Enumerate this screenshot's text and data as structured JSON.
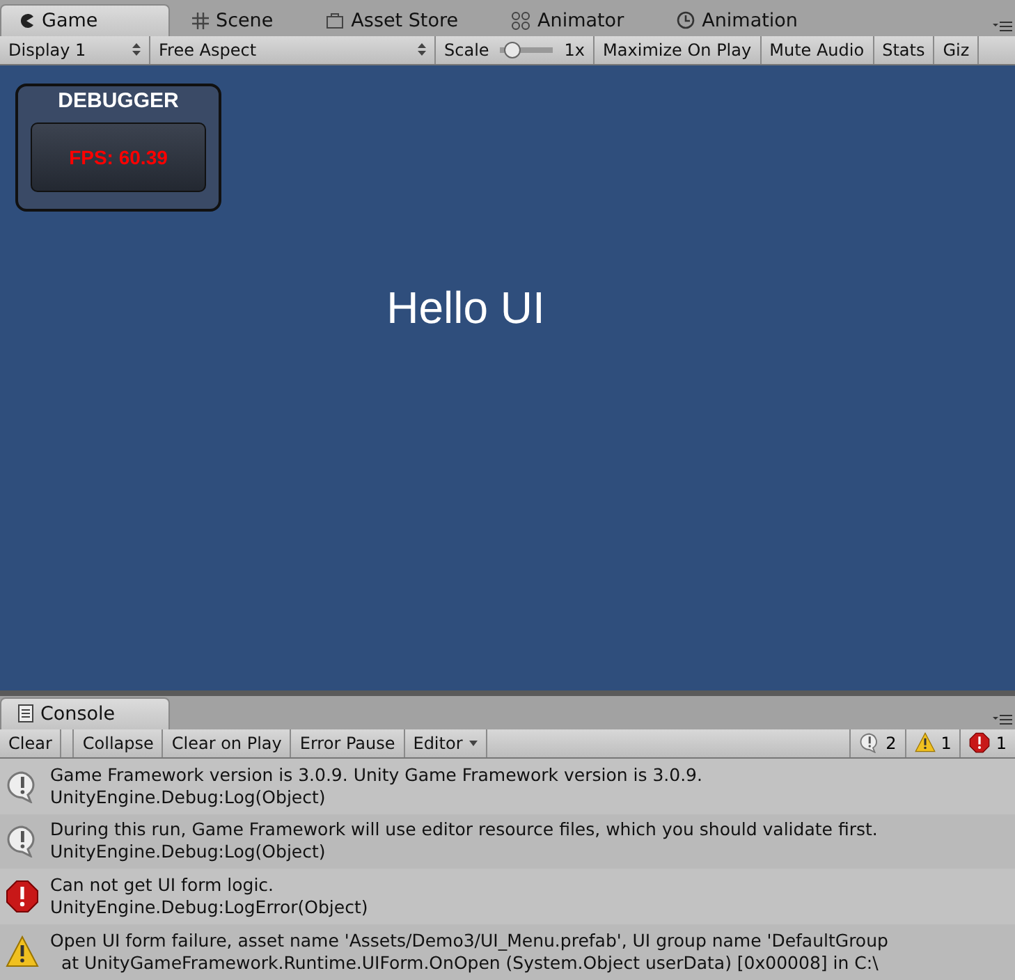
{
  "tabs": [
    {
      "label": "Game",
      "kind": "game",
      "selected": true
    },
    {
      "label": "Scene",
      "kind": "grid",
      "selected": false
    },
    {
      "label": "Asset Store",
      "kind": "bag",
      "selected": false
    },
    {
      "label": "Animator",
      "kind": "nodes",
      "selected": false
    },
    {
      "label": "Animation",
      "kind": "clock",
      "selected": false
    }
  ],
  "toolbar": {
    "display": "Display 1",
    "aspect": "Free Aspect",
    "scale_label": "Scale",
    "scale": {
      "level": 0.1
    },
    "scale_value": "1x",
    "toggles": [
      "Maximize On Play",
      "Mute Audio",
      "Stats",
      "Giz"
    ]
  },
  "game_view": {
    "debugger": {
      "title": "DEBUGGER",
      "fps": "FPS: 60.39"
    },
    "text": "Hello UI"
  },
  "console": {
    "tab": "Console",
    "buttons": [
      {
        "label": "Clear",
        "kind": "button"
      },
      {
        "label": "Collapse",
        "kind": "button"
      },
      {
        "label": "Clear on Play",
        "kind": "button"
      },
      {
        "label": "Error Pause",
        "kind": "button"
      },
      {
        "label": "Editor",
        "kind": "dropdown"
      }
    ],
    "counts": [
      {
        "kind": "info",
        "count": "2"
      },
      {
        "kind": "warning",
        "count": "1"
      },
      {
        "kind": "error",
        "count": "1"
      }
    ],
    "logs": [
      {
        "kind": "info",
        "message": "Game Framework version is 3.0.9. Unity Game Framework version is 3.0.9.",
        "trace": "UnityEngine.Debug:Log(Object)"
      },
      {
        "kind": "info",
        "message": "During this run, Game Framework will use editor resource files, which you should validate first.",
        "trace": "UnityEngine.Debug:Log(Object)"
      },
      {
        "kind": "error",
        "message": "Can not get UI form logic.",
        "trace": "UnityEngine.Debug:LogError(Object)"
      },
      {
        "kind": "warning",
        "message": "Open UI form failure, asset name 'Assets/Demo3/UI_Menu.prefab', UI group name 'DefaultGroup",
        "trace": "  at UnityGameFramework.Runtime.UIForm.OnOpen (System.Object userData) [0x00008] in C:\\"
      }
    ]
  }
}
